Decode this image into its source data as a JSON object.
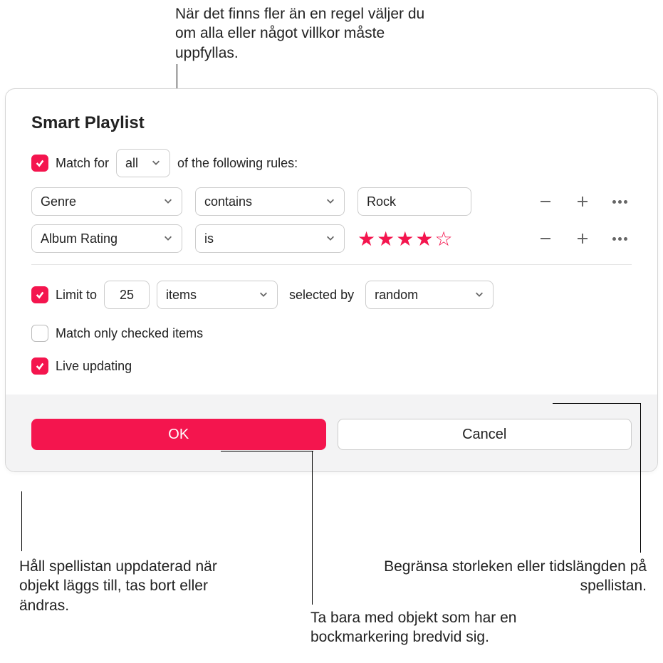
{
  "annotations": {
    "top": "När det finns fler än en regel väljer du om alla eller något villkor måste uppfyllas.",
    "bottom_left": "Håll spellistan uppdaterad när objekt läggs till, tas bort eller ändras.",
    "bottom_right_top": "Begränsa storleken eller tidslängden på spellistan.",
    "bottom_right_bottom": "Ta bara med objekt som har en bockmarkering bredvid sig."
  },
  "dialog": {
    "title": "Smart Playlist",
    "match_row": {
      "label_before": "Match for",
      "selector_value": "all",
      "label_after": "of the following rules:"
    },
    "rules": [
      {
        "field": "Genre",
        "operator": "contains",
        "value": "Rock",
        "value_type": "text"
      },
      {
        "field": "Album Rating",
        "operator": "is",
        "value": "4",
        "value_type": "stars"
      }
    ],
    "limit_row": {
      "label": "Limit to",
      "count": "25",
      "unit": "items",
      "label_mid": "selected by",
      "by": "random"
    },
    "match_checked_label": "Match only checked items",
    "live_updating_label": "Live updating",
    "buttons": {
      "ok": "OK",
      "cancel": "Cancel"
    }
  }
}
